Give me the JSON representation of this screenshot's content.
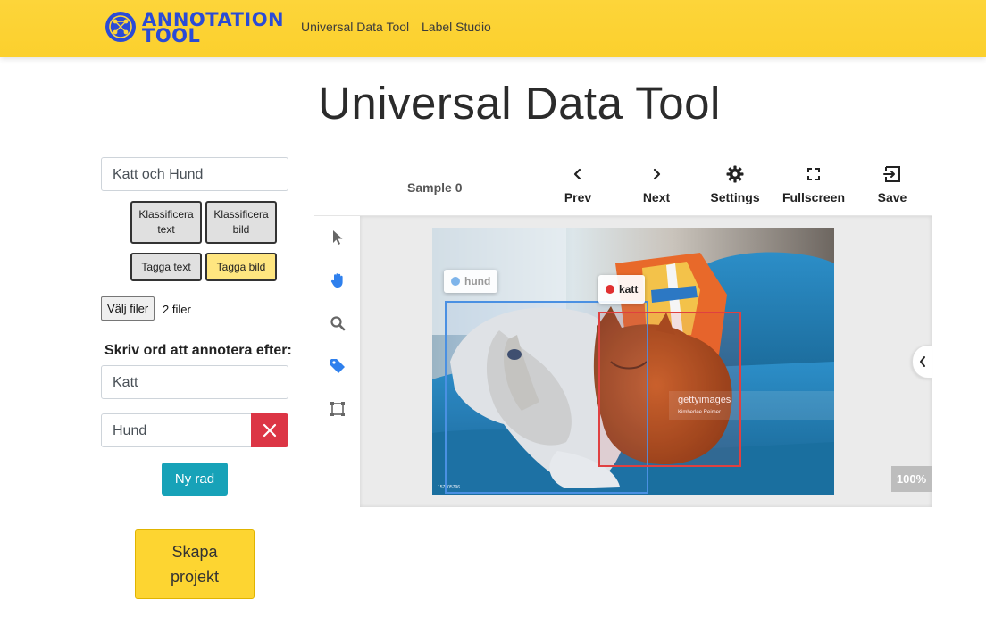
{
  "navbar": {
    "logo_line1": "ANNOTATION",
    "logo_line2": "TOOL",
    "links": [
      "Universal Data Tool",
      "Label Studio"
    ],
    "logo_color": "#2a4bd6",
    "background": "#fdd53a"
  },
  "page_title": "Universal Data Tool",
  "form": {
    "project_name_value": "Katt och Hund",
    "type_buttons": [
      {
        "label": "Klassificera text",
        "active": false
      },
      {
        "label": "Klassificera bild",
        "active": false
      },
      {
        "label": "Tagga text",
        "active": false
      },
      {
        "label": "Tagga bild",
        "active": true
      }
    ],
    "file_button_label": "Välj filer",
    "file_count": "2 filer",
    "words_label": "Skriv ord att annotera efter:",
    "words": [
      "Katt",
      "Hund"
    ],
    "new_row_label": "Ny rad",
    "create_label": "Skapa projekt"
  },
  "annotator": {
    "sample_label": "Sample 0",
    "toolbar": [
      {
        "label": "Prev",
        "icon": "chevron-left-icon"
      },
      {
        "label": "Next",
        "icon": "chevron-right-icon"
      },
      {
        "label": "Settings",
        "icon": "gear-icon"
      },
      {
        "label": "Fullscreen",
        "icon": "fullscreen-icon"
      },
      {
        "label": "Save",
        "icon": "exit-icon"
      }
    ],
    "side_tools": [
      "cursor-icon",
      "hand-icon",
      "magnifier-icon",
      "tag-icon",
      "box-tool-icon"
    ],
    "zoom": "100%",
    "regions": [
      {
        "label": "hund",
        "color": "#4a90e2"
      },
      {
        "label": "katt",
        "color": "#e04040"
      }
    ],
    "watermark": "gettyimages",
    "watermark_sub": "Kimberlee Reimer",
    "photo_credit": "157205796"
  }
}
